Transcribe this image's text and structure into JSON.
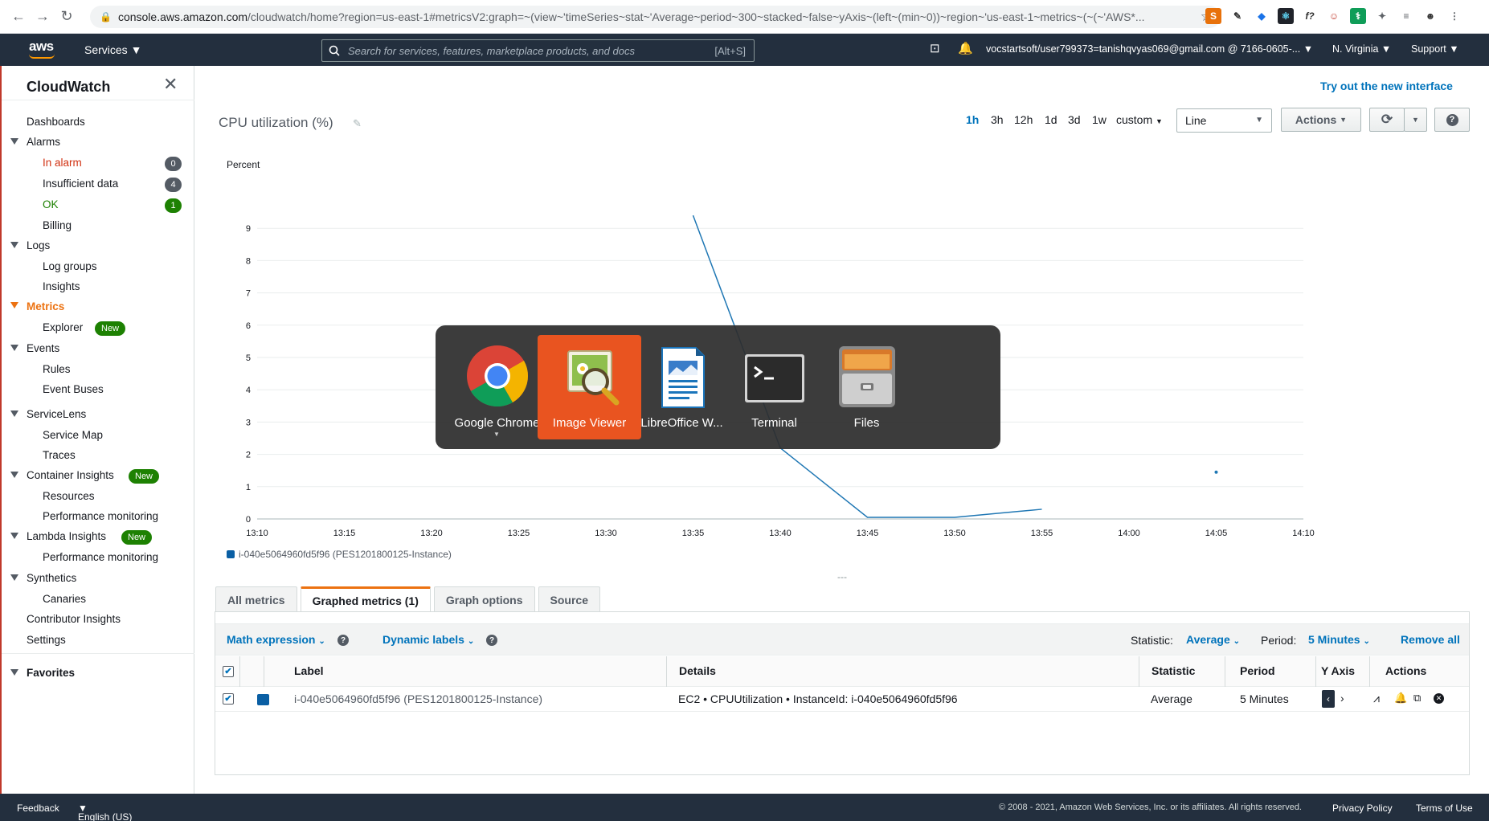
{
  "browser": {
    "url_host": "console.aws.amazon.com",
    "url_rest": "/cloudwatch/home?region=us-east-1#metricsV2:graph=~(view~'timeSeries~stat~'Average~period~300~stacked~false~yAxis~(left~(min~0))~region~'us-east-1~metrics~(~(~'AWS*...",
    "back_icon": "←",
    "forward_icon": "→",
    "reload_icon": "↻",
    "star_icon": "☆"
  },
  "aws_nav": {
    "logo": "aws",
    "services": "Services",
    "search_placeholder": "Search for services, features, marketplace products, and docs",
    "search_shortcut": "[Alt+S]",
    "account": "vocstartsoft/user799373=tanishqvyas069@gmail.com @ 7166-0605-...",
    "region": "N. Virginia",
    "support": "Support"
  },
  "sidebar": {
    "title": "CloudWatch",
    "dashboards": "Dashboards",
    "alarms": "Alarms",
    "in_alarm": "In alarm",
    "in_alarm_count": "0",
    "insufficient": "Insufficient data",
    "insufficient_count": "4",
    "ok": "OK",
    "ok_count": "1",
    "billing": "Billing",
    "logs": "Logs",
    "log_groups": "Log groups",
    "insights": "Insights",
    "metrics": "Metrics",
    "explorer": "Explorer",
    "new": "New",
    "events": "Events",
    "rules": "Rules",
    "event_buses": "Event Buses",
    "servicelens": "ServiceLens",
    "service_map": "Service Map",
    "traces": "Traces",
    "container_insights": "Container Insights",
    "resources": "Resources",
    "perf_monitoring": "Performance monitoring",
    "lambda_insights": "Lambda Insights",
    "synthetics": "Synthetics",
    "canaries": "Canaries",
    "contributor_insights": "Contributor Insights",
    "settings": "Settings",
    "favorites": "Favorites"
  },
  "main": {
    "try_new": "Try out the new interface",
    "graph_title": "CPU utilization (%)",
    "time_ranges": [
      "1h",
      "3h",
      "12h",
      "1d",
      "3d",
      "1w"
    ],
    "custom": "custom",
    "chart_type": "Line",
    "actions": "Actions"
  },
  "chart_data": {
    "type": "line",
    "title": "CPU utilization (%)",
    "ylabel": "Percent",
    "ylim": [
      0,
      9.5
    ],
    "y_ticks": [
      "0",
      "1",
      "2",
      "3",
      "4",
      "5",
      "6",
      "7",
      "8",
      "9"
    ],
    "x_ticks": [
      "13:10",
      "13:15",
      "13:20",
      "13:25",
      "13:30",
      "13:35",
      "13:40",
      "13:45",
      "13:50",
      "13:55",
      "14:00",
      "14:05",
      "14:10"
    ],
    "series": [
      {
        "name": "i-040e5064960fd5f96 (PES1201800125-Instance)",
        "color": "#1f77b4",
        "x": [
          "13:35",
          "13:40",
          "13:45",
          "13:50",
          "13:55"
        ],
        "values": [
          9.4,
          2.2,
          0.05,
          0.05,
          0.3
        ]
      }
    ],
    "isolated_point": {
      "x": "14:05",
      "value": 1.45
    }
  },
  "tabs": [
    "All metrics",
    "Graphed metrics (1)",
    "Graph options",
    "Source"
  ],
  "toolbar": {
    "math_expression": "Math expression",
    "dynamic_labels": "Dynamic labels",
    "statistic_label": "Statistic:",
    "statistic_value": "Average",
    "period_label": "Period:",
    "period_value": "5 Minutes",
    "remove_all": "Remove all"
  },
  "table": {
    "headers": [
      "Label",
      "Details",
      "Statistic",
      "Period",
      "Y Axis",
      "Actions"
    ],
    "row": {
      "label": "i-040e5064960fd5f96 (PES1201800125-Instance)",
      "details": "EC2 • CPUUtilization • InstanceId: i-040e5064960fd5f96",
      "statistic": "Average",
      "period": "5 Minutes"
    }
  },
  "switcher": {
    "apps": [
      "Google Chrome",
      "Image Viewer",
      "LibreOffice W...",
      "Terminal",
      "Files"
    ]
  },
  "footer": {
    "feedback": "Feedback",
    "language": "English (US)",
    "copyright": "© 2008 - 2021, Amazon Web Services, Inc. or its affiliates. All rights reserved.",
    "privacy": "Privacy Policy",
    "terms": "Terms of Use"
  }
}
